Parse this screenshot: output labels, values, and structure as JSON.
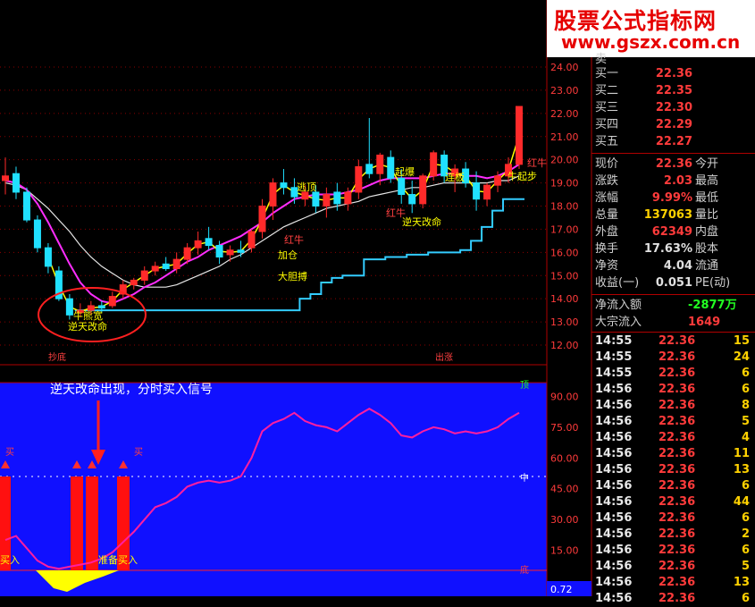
{
  "watermark": {
    "line1": "股票公式指标网",
    "line2": "www.gszx.com.cn"
  },
  "colors": {
    "up": "#ff2a2a",
    "down": "#20e0ff",
    "ma_white": "#e6e6e6",
    "ma_magenta": "#ff2dff",
    "ma_yellow": "#ffff00",
    "stop_line": "#33ccff",
    "grid": "#8b0000",
    "oscillator_line": "#ff1ea0",
    "oscillator_bg": "#1010ff"
  },
  "labels": {
    "qianxi": "抄底",
    "chushi": "出涨",
    "tiao": "逃顶",
    "hongniu1": "红牛",
    "hongniu2": "红牛",
    "hongniu3": "红牛",
    "jiacang": "加仓",
    "dadanbo": "大胆搏",
    "niyao1": "逆天改命",
    "niyao2": "逆天改命",
    "xiaqu": "牛起步",
    "lianqi": "连板",
    "qidong": "起爆",
    "bottom_pit": "牛熊宽",
    "signal_note": "逆天改命出现，分时买入信号",
    "buy1": "买入",
    "buy2": "准备买入",
    "buy3": "买",
    "buy4": "买",
    "top_mark": "顶",
    "mid_mark": "中",
    "bot_mark": "底",
    "osc_reading": "0.72"
  },
  "chart_data": {
    "type": "candlestick",
    "price_axis": {
      "ticks": [
        "24.00",
        "23.00",
        "22.00",
        "21.00",
        "20.00",
        "19.00",
        "18.00",
        "17.00",
        "16.00",
        "15.00",
        "14.00",
        "13.00",
        "12.00"
      ],
      "ylim": [
        11.5,
        25.2
      ]
    },
    "osc_axis": {
      "ticks": [
        "90.00",
        "75.00",
        "60.00",
        "45.00",
        "30.00",
        "15.00"
      ],
      "ylim": [
        0,
        95
      ]
    },
    "candles": [
      {
        "o": 19.1,
        "h": 20.1,
        "l": 18.5,
        "c": 19.3,
        "up": true
      },
      {
        "o": 19.4,
        "h": 19.7,
        "l": 18.3,
        "c": 18.6,
        "up": false
      },
      {
        "o": 18.6,
        "h": 18.8,
        "l": 17.3,
        "c": 17.4,
        "up": false
      },
      {
        "o": 17.4,
        "h": 17.6,
        "l": 16.0,
        "c": 16.2,
        "up": false
      },
      {
        "o": 16.2,
        "h": 16.4,
        "l": 15.1,
        "c": 15.4,
        "up": false
      },
      {
        "o": 15.2,
        "h": 15.4,
        "l": 13.9,
        "c": 14.0,
        "up": false
      },
      {
        "o": 14.0,
        "h": 14.2,
        "l": 13.1,
        "c": 13.3,
        "up": false
      },
      {
        "o": 13.4,
        "h": 13.8,
        "l": 13.2,
        "c": 13.5,
        "up": true
      },
      {
        "o": 13.5,
        "h": 13.9,
        "l": 13.3,
        "c": 13.7,
        "up": true
      },
      {
        "o": 13.7,
        "h": 13.9,
        "l": 13.4,
        "c": 13.6,
        "up": false
      },
      {
        "o": 13.7,
        "h": 14.3,
        "l": 13.6,
        "c": 14.1,
        "up": true
      },
      {
        "o": 14.2,
        "h": 14.8,
        "l": 14.0,
        "c": 14.6,
        "up": true
      },
      {
        "o": 14.6,
        "h": 14.9,
        "l": 14.4,
        "c": 14.8,
        "up": true
      },
      {
        "o": 14.8,
        "h": 15.4,
        "l": 14.6,
        "c": 15.2,
        "up": true
      },
      {
        "o": 15.2,
        "h": 15.6,
        "l": 15.0,
        "c": 15.4,
        "up": true
      },
      {
        "o": 15.5,
        "h": 15.8,
        "l": 15.2,
        "c": 15.3,
        "up": false
      },
      {
        "o": 15.3,
        "h": 16.0,
        "l": 15.1,
        "c": 15.7,
        "up": true
      },
      {
        "o": 15.7,
        "h": 16.4,
        "l": 15.5,
        "c": 16.2,
        "up": true
      },
      {
        "o": 16.2,
        "h": 16.9,
        "l": 15.9,
        "c": 16.5,
        "up": true
      },
      {
        "o": 16.6,
        "h": 17.1,
        "l": 16.1,
        "c": 16.3,
        "up": false
      },
      {
        "o": 16.3,
        "h": 16.5,
        "l": 15.5,
        "c": 15.8,
        "up": false
      },
      {
        "o": 15.9,
        "h": 16.3,
        "l": 15.6,
        "c": 16.1,
        "up": true
      },
      {
        "o": 16.1,
        "h": 16.5,
        "l": 15.8,
        "c": 16.0,
        "up": false
      },
      {
        "o": 16.2,
        "h": 17.0,
        "l": 16.0,
        "c": 16.9,
        "up": true
      },
      {
        "o": 16.9,
        "h": 18.3,
        "l": 16.6,
        "c": 18.0,
        "up": true
      },
      {
        "o": 18.0,
        "h": 19.2,
        "l": 17.4,
        "c": 19.0,
        "up": true
      },
      {
        "o": 19.0,
        "h": 19.6,
        "l": 18.5,
        "c": 18.8,
        "up": false
      },
      {
        "o": 18.8,
        "h": 19.2,
        "l": 18.1,
        "c": 18.4,
        "up": false
      },
      {
        "o": 18.3,
        "h": 18.9,
        "l": 18.0,
        "c": 18.6,
        "up": true
      },
      {
        "o": 18.6,
        "h": 18.9,
        "l": 17.7,
        "c": 18.0,
        "up": false
      },
      {
        "o": 18.0,
        "h": 18.8,
        "l": 17.5,
        "c": 18.5,
        "up": true
      },
      {
        "o": 18.6,
        "h": 19.0,
        "l": 17.8,
        "c": 18.1,
        "up": false
      },
      {
        "o": 18.1,
        "h": 18.8,
        "l": 17.8,
        "c": 18.6,
        "up": true
      },
      {
        "o": 18.6,
        "h": 20.0,
        "l": 18.3,
        "c": 19.7,
        "up": true
      },
      {
        "o": 19.8,
        "h": 21.8,
        "l": 19.2,
        "c": 19.4,
        "up": false
      },
      {
        "o": 19.4,
        "h": 20.3,
        "l": 18.9,
        "c": 20.2,
        "up": true
      },
      {
        "o": 20.1,
        "h": 20.4,
        "l": 19.0,
        "c": 19.2,
        "up": false
      },
      {
        "o": 19.2,
        "h": 19.6,
        "l": 18.1,
        "c": 18.5,
        "up": false
      },
      {
        "o": 18.5,
        "h": 19.1,
        "l": 17.7,
        "c": 18.1,
        "up": false
      },
      {
        "o": 18.1,
        "h": 19.4,
        "l": 17.9,
        "c": 19.3,
        "up": true
      },
      {
        "o": 19.3,
        "h": 20.4,
        "l": 19.1,
        "c": 20.3,
        "up": true
      },
      {
        "o": 20.2,
        "h": 20.4,
        "l": 19.0,
        "c": 19.3,
        "up": false
      },
      {
        "o": 19.3,
        "h": 19.8,
        "l": 18.6,
        "c": 19.6,
        "up": true
      },
      {
        "o": 19.6,
        "h": 19.9,
        "l": 18.8,
        "c": 19.0,
        "up": false
      },
      {
        "o": 19.0,
        "h": 19.5,
        "l": 17.8,
        "c": 18.3,
        "up": false
      },
      {
        "o": 18.3,
        "h": 19.0,
        "l": 18.0,
        "c": 18.9,
        "up": true
      },
      {
        "o": 18.9,
        "h": 19.5,
        "l": 18.6,
        "c": 19.3,
        "up": true
      },
      {
        "o": 19.3,
        "h": 20.1,
        "l": 19.0,
        "c": 19.8,
        "up": true
      },
      {
        "o": 19.8,
        "h": 22.3,
        "l": 19.6,
        "c": 22.3,
        "up": true
      }
    ],
    "ma_white": [
      19.0,
      18.9,
      18.7,
      18.3,
      17.9,
      17.4,
      16.9,
      16.3,
      15.8,
      15.4,
      15.1,
      14.8,
      14.6,
      14.5,
      14.5,
      14.5,
      14.6,
      14.8,
      15.0,
      15.2,
      15.4,
      15.7,
      15.9,
      16.2,
      16.5,
      16.8,
      17.1,
      17.3,
      17.5,
      17.7,
      17.9,
      18.0,
      18.1,
      18.2,
      18.4,
      18.5,
      18.6,
      18.7,
      18.8,
      18.8,
      18.9,
      19.0,
      19.0,
      19.0,
      19.0,
      19.0,
      19.1,
      19.1,
      19.3
    ],
    "ma_magenta": [
      19.1,
      19.0,
      18.7,
      18.1,
      17.3,
      16.4,
      15.5,
      14.7,
      14.2,
      13.9,
      13.8,
      14.0,
      14.2,
      14.5,
      14.7,
      15.0,
      15.3,
      15.6,
      15.8,
      16.1,
      16.3,
      16.5,
      16.7,
      17.0,
      17.3,
      17.7,
      18.0,
      18.3,
      18.4,
      18.5,
      18.5,
      18.5,
      18.6,
      18.7,
      18.9,
      19.1,
      19.2,
      19.2,
      19.2,
      19.2,
      19.3,
      19.4,
      19.4,
      19.3,
      19.3,
      19.2,
      19.3,
      19.5,
      19.8
    ],
    "ma_yellow_idx": [
      4,
      5,
      6,
      7,
      8,
      9,
      10,
      11,
      12,
      13,
      14,
      15,
      16,
      17,
      18,
      19,
      20,
      21,
      22,
      23,
      24,
      25,
      26,
      27,
      28,
      29,
      30,
      31,
      32,
      33,
      34,
      35,
      36,
      37,
      38,
      39,
      40,
      41,
      42,
      43,
      44,
      45,
      46,
      47,
      48
    ],
    "stop_line": [
      null,
      null,
      null,
      null,
      null,
      null,
      null,
      13.5,
      13.5,
      13.5,
      13.5,
      13.5,
      13.5,
      13.5,
      13.5,
      13.5,
      13.5,
      13.5,
      13.5,
      13.5,
      13.5,
      13.5,
      13.5,
      13.5,
      13.5,
      13.5,
      13.5,
      13.5,
      14.0,
      14.2,
      14.7,
      14.9,
      15.0,
      15.0,
      15.7,
      15.7,
      15.8,
      15.8,
      15.9,
      15.9,
      16.0,
      16.0,
      16.0,
      16.1,
      16.5,
      17.1,
      17.8,
      18.3,
      18.3
    ],
    "oscillator": [
      20,
      22,
      16,
      10,
      7,
      6,
      7,
      8,
      9,
      11,
      14,
      19,
      24,
      30,
      36,
      38,
      41,
      46,
      48,
      49,
      48,
      49,
      51,
      60,
      73,
      77,
      79,
      82,
      78,
      76,
      75,
      73,
      77,
      81,
      84,
      81,
      77,
      71,
      70,
      73,
      75,
      74,
      72,
      73,
      72,
      73,
      75,
      79,
      82
    ],
    "signal_bars_idx": [
      0,
      15,
      17,
      22
    ]
  },
  "quote_panel": {
    "bid": [
      {
        "label": "买一",
        "price": "22.36",
        "extra": ""
      },
      {
        "label": "买二",
        "price": "22.35",
        "extra": ""
      },
      {
        "label": "买三",
        "price": "22.30",
        "extra": ""
      },
      {
        "label": "买四",
        "price": "22.29",
        "extra": ""
      },
      {
        "label": "买五",
        "price": "22.27",
        "extra": ""
      }
    ],
    "ask_top_label": "卖",
    "stats": [
      {
        "label": "现价",
        "value": "22.36",
        "label2": "今开",
        "color": "#ff3b3b"
      },
      {
        "label": "涨跌",
        "value": "2.03",
        "label2": "最高",
        "color": "#ff3b3b"
      },
      {
        "label": "涨幅",
        "value": "9.99%",
        "label2": "最低",
        "color": "#ff3b3b"
      },
      {
        "label": "总量",
        "value": "137063",
        "label2": "量比",
        "color": "#ffd200"
      },
      {
        "label": "外盘",
        "value": "62349",
        "label2": "内盘",
        "color": "#ff3b3b"
      },
      {
        "label": "换手",
        "value": "17.63%",
        "label2": "股本",
        "color": "#e0e0e0"
      },
      {
        "label": "净资",
        "value": "4.04",
        "label2": "流通",
        "color": "#e0e0e0"
      },
      {
        "label": "收益(一)",
        "value": "0.051",
        "label2": "PE(动)",
        "color": "#e0e0e0"
      }
    ],
    "flow": [
      {
        "label": "净流入额",
        "value": "-2877万",
        "color": "#22ff22"
      },
      {
        "label": "大宗流入",
        "value": "1649",
        "color": "#ff3b3b"
      }
    ],
    "ticks": [
      {
        "t": "14:55",
        "p": "22.36",
        "v": "15"
      },
      {
        "t": "14:55",
        "p": "22.36",
        "v": "24"
      },
      {
        "t": "14:55",
        "p": "22.36",
        "v": "6"
      },
      {
        "t": "14:56",
        "p": "22.36",
        "v": "6"
      },
      {
        "t": "14:56",
        "p": "22.36",
        "v": "8"
      },
      {
        "t": "14:56",
        "p": "22.36",
        "v": "5"
      },
      {
        "t": "14:56",
        "p": "22.36",
        "v": "4"
      },
      {
        "t": "14:56",
        "p": "22.36",
        "v": "11"
      },
      {
        "t": "14:56",
        "p": "22.36",
        "v": "13"
      },
      {
        "t": "14:56",
        "p": "22.36",
        "v": "6"
      },
      {
        "t": "14:56",
        "p": "22.36",
        "v": "44"
      },
      {
        "t": "14:56",
        "p": "22.36",
        "v": "6"
      },
      {
        "t": "14:56",
        "p": "22.36",
        "v": "2"
      },
      {
        "t": "14:56",
        "p": "22.36",
        "v": "6"
      },
      {
        "t": "14:56",
        "p": "22.36",
        "v": "5"
      },
      {
        "t": "14:56",
        "p": "22.36",
        "v": "13"
      },
      {
        "t": "14:56",
        "p": "22.36",
        "v": "6"
      }
    ]
  }
}
